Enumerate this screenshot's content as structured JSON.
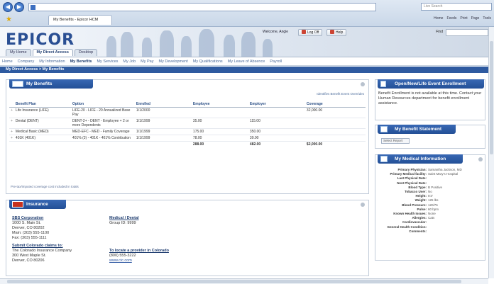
{
  "browser": {
    "tab_title": "My Benefits - Epicor HCM",
    "search_placeholder": "Live Search",
    "commands": [
      "Home",
      "Feeds",
      "Print",
      "Page",
      "Tools"
    ]
  },
  "header": {
    "logo": "EPICOR",
    "welcome": "Welcome, Angie",
    "logout": "Log Off",
    "help": "Help",
    "find_label": "Find",
    "portal_tabs": [
      {
        "label": "My Home"
      },
      {
        "label": "My Direct Access"
      },
      {
        "label": "Desktop"
      }
    ]
  },
  "nav": {
    "items": [
      "Home",
      "Company",
      "My Information",
      "My Benefits",
      "My Services",
      "My Job",
      "My Pay",
      "My Development",
      "My Qualifications",
      "My Leave of Absence",
      "Payroll"
    ],
    "current": "My Benefits"
  },
  "breadcrumb": "My Direct Access > My Benefits",
  "benefits": {
    "title": "My Benefits",
    "legend_link": "Identifies Benefit Event Overrides",
    "columns": [
      "Benefit Plan",
      "Option",
      "Enrolled",
      "Employee",
      "Employer",
      "Coverage"
    ],
    "rows": [
      {
        "plan": "Life Insurance (LIFE)",
        "option": "LIFE-20 - LIFE - 20 Annualized Base Pay",
        "enrolled": "1/1/2000",
        "employee": "",
        "employer": "",
        "coverage": "32,000.00"
      },
      {
        "plan": "Dental (DENT)",
        "option": "DENT-2+ - DENT - Employee + 2 or more Dependents",
        "enrolled": "1/1/1999",
        "employee": "35.00",
        "employer": "115.00",
        "coverage": ""
      },
      {
        "plan": "Medical Basic (MED)",
        "option": "MED-EFC - MED - Family Coverage",
        "enrolled": "1/1/1999",
        "employee": "175.00",
        "employer": "350.00",
        "coverage": ""
      },
      {
        "plan": "401K (401K)",
        "option": "401% (3) - 401K - 401% Contribution",
        "enrolled": "1/1/1999",
        "employee": "78.00",
        "employer": "39.00",
        "coverage": ""
      }
    ],
    "totals": {
      "employee": "288.00",
      "employer": "482.00",
      "coverage": "$2,000.00"
    },
    "footnote": "Pre-tax/imputed coverage cost included in totals"
  },
  "insurance": {
    "title": "Insurance",
    "company_name": "SBS Corporation",
    "company_lines": [
      "1000 S. Main St.",
      "Denver, CO 80202",
      "Main: (303) 555-1100",
      "Fax: (303) 555-1111"
    ],
    "group_name": "Medical / Dental",
    "group_line": "Group ID: 9999",
    "claims_head": "Submit Colorado claims to:",
    "claims_lines": [
      "The Colorado Insurance Company",
      "300 West Maple St.",
      "Denver, CO 80206"
    ],
    "provider_head": "To locate a provider in Colorado",
    "provider_lines": [
      "(800) 555-3222"
    ],
    "provider_link": "www.cic.com"
  },
  "enrollment": {
    "title": "Open/New/Life Event Enrollment",
    "text": "Benefit Enrollment is not available at this time. Contact your Human Resources department for benefit enrollment assistance."
  },
  "statement": {
    "title": "My Benefit Statement",
    "select": "Select Report"
  },
  "medical": {
    "title": "My Medical Information",
    "fields": [
      {
        "k": "Primary Physician:",
        "v": "Samantha Jackson, MD"
      },
      {
        "k": "Primary Medical facility:",
        "v": "Saint Mary's Hospital"
      },
      {
        "k": "Last Physical Date:",
        "v": ""
      },
      {
        "k": "Next Physical Date:",
        "v": ""
      },
      {
        "k": "Blood Type:",
        "v": "B Positive"
      },
      {
        "k": "Tobacco User:",
        "v": "No"
      },
      {
        "k": "Height:",
        "v": "5'3\""
      },
      {
        "k": "Weight:",
        "v": "125 lbs"
      },
      {
        "k": "Blood Pressure:",
        "v": "120/76"
      },
      {
        "k": "Pulse:",
        "v": "60 bpm"
      },
      {
        "k": "Known Health Issues:",
        "v": "None"
      },
      {
        "k": "Allergies:",
        "v": "Cats"
      },
      {
        "k": "Cardiovascular:",
        "v": ""
      },
      {
        "k": "General Health Condition:",
        "v": ""
      },
      {
        "k": "Comments:",
        "v": ""
      }
    ]
  }
}
